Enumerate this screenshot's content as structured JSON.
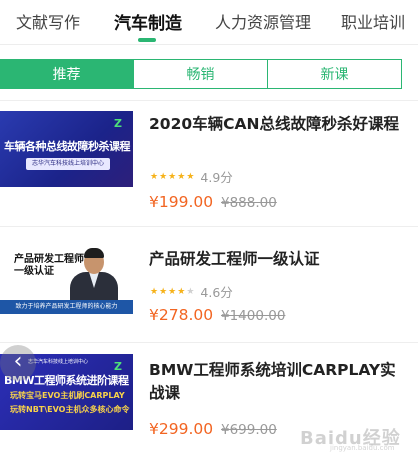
{
  "category_tabs": [
    {
      "label": "文献写作"
    },
    {
      "label": "汽车制造"
    },
    {
      "label": "人力资源管理"
    },
    {
      "label": "职业培训"
    }
  ],
  "active_category": "汽车制造",
  "sub_tabs": [
    {
      "label": "推荐"
    },
    {
      "label": "畅销"
    },
    {
      "label": "新课"
    }
  ],
  "active_sub_tab": "推荐",
  "accent_color": "#2bb673",
  "price_color": "#f26522",
  "star_color": "#f6b21a",
  "courses": [
    {
      "title": "2020车辆CAN总线故障秒杀好课程",
      "rating": 4.9,
      "score_label": "4.9分",
      "price": "¥199.00",
      "original_price": "¥888.00",
      "thumb": {
        "logo": "Z",
        "headline": "车辆各种总线故障秒杀课程",
        "sub": "志华汽车科技线上培训中心"
      }
    },
    {
      "title": "产品研发工程师一级认证",
      "rating": 4.6,
      "score_label": "4.6分",
      "price": "¥278.00",
      "original_price": "¥1400.00",
      "thumb": {
        "headline": "产品研发工程师一级认证",
        "footer": "致力于培养产品研发工程师的核心能力"
      }
    },
    {
      "title": "BMW工程师系统培训CARPLAY实战课",
      "rating": null,
      "price": "¥299.00",
      "original_price": "¥699.00",
      "thumb": {
        "logo": "Z",
        "top": "志华汽车科技线上培训中心",
        "headline": "BMW工程师系统进阶课程",
        "line2": "玩转宝马EVO主机刷CARPLAY",
        "line3": "玩转NBT\\EVO主机众多核心命令"
      }
    }
  ],
  "watermark": {
    "text": "Baidu经验",
    "sub": "jingyan.baidu.com"
  }
}
